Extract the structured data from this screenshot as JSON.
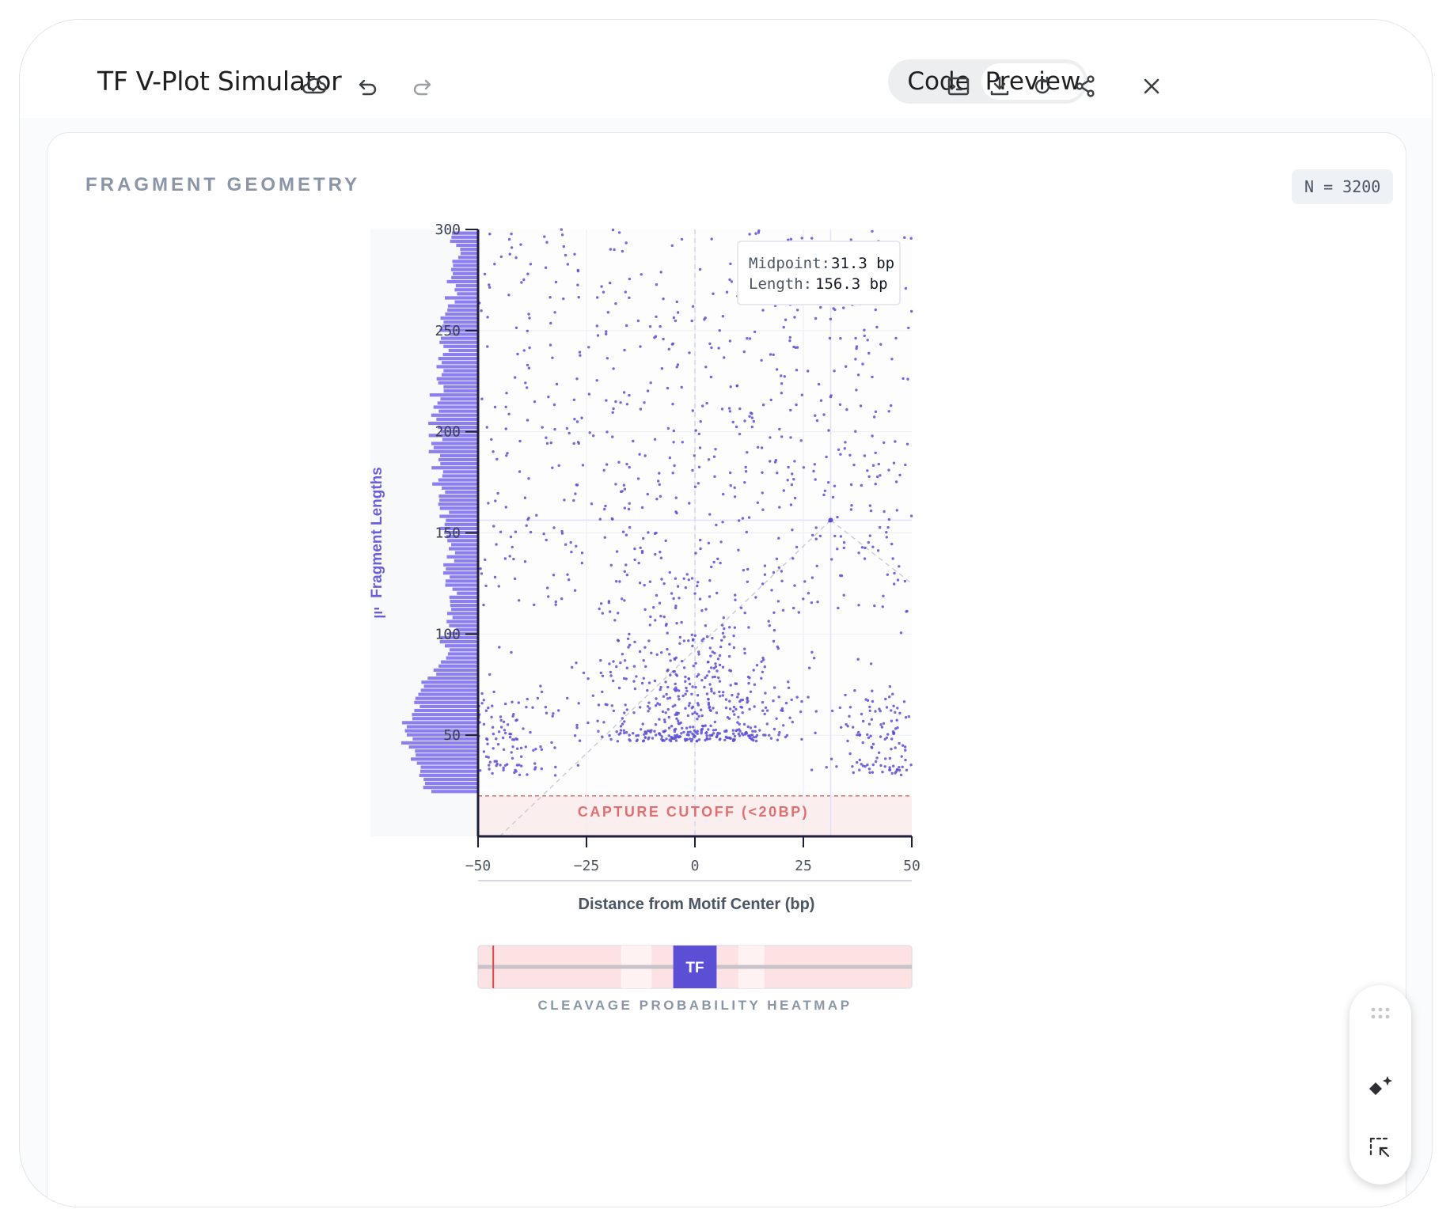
{
  "app": {
    "title": "TF V-Plot Simulator",
    "mode_code": "Code",
    "mode_preview": "Preview",
    "active_mode": "Preview"
  },
  "toolbar_icons": [
    "cloud-sync-icon",
    "undo-icon",
    "redo-icon",
    "terminal-icon",
    "download-icon",
    "refresh-icon",
    "share-icon",
    "close-icon"
  ],
  "card": {
    "title": "FRAGMENT GEOMETRY",
    "count": "N = 3200"
  },
  "tooltip": {
    "midpoint_label": "Midpoint:",
    "midpoint_value": "31.3 bp",
    "length_label": "Length:",
    "length_value": "156.3 bp"
  },
  "heatmap": {
    "label": "CLEAVAGE PROBABILITY HEATMAP",
    "tf_label": "TF"
  },
  "colors": {
    "point": "#5b4fd6",
    "histogram": "#8b7ff0",
    "cutoff": "#e07070",
    "axis": "#1e1e3c",
    "tf_block": "#5b4fd6"
  },
  "chart_data": {
    "type": "scatter",
    "title": "",
    "xlabel": "Distance from Motif Center (bp)",
    "ylabel": "Fragment Lengths",
    "xlim": [
      -50,
      50
    ],
    "ylim": [
      0,
      300
    ],
    "xticks": [
      -50,
      -25,
      0,
      25,
      50
    ],
    "xtick_labels": [
      "−50",
      "−25",
      "0",
      "25",
      "50"
    ],
    "yticks": [
      50,
      100,
      150,
      200,
      250,
      300
    ],
    "ytick_labels": [
      "50",
      "100",
      "150",
      "200",
      "250",
      "300"
    ],
    "cutoff": {
      "y": 20,
      "label": "CAPTURE CUTOFF (<20BP)"
    },
    "highlight": {
      "x": 31.3,
      "y": 156.3
    },
    "n_points": 3200,
    "histogram_peak_length": 50,
    "point_clusters": [
      {
        "name": "",
        "x_center": -45,
        "y_center": 48,
        "x_spread": 7,
        "y_spread": 18,
        "share": 0.1
      },
      {
        "name": "",
        "x_center": 45,
        "y_center": 48,
        "x_spread": 7,
        "y_spread": 18,
        "share": 0.1
      },
      {
        "name": "",
        "x_center": 0,
        "y_center": 65,
        "x_spread": 12,
        "y_spread": 25,
        "share": 0.36
      },
      {
        "name": "",
        "x_center": 0,
        "y_center": 195,
        "x_spread": 50,
        "y_spread": 50,
        "share": 0.44
      }
    ],
    "grid": true,
    "legend": "none"
  }
}
